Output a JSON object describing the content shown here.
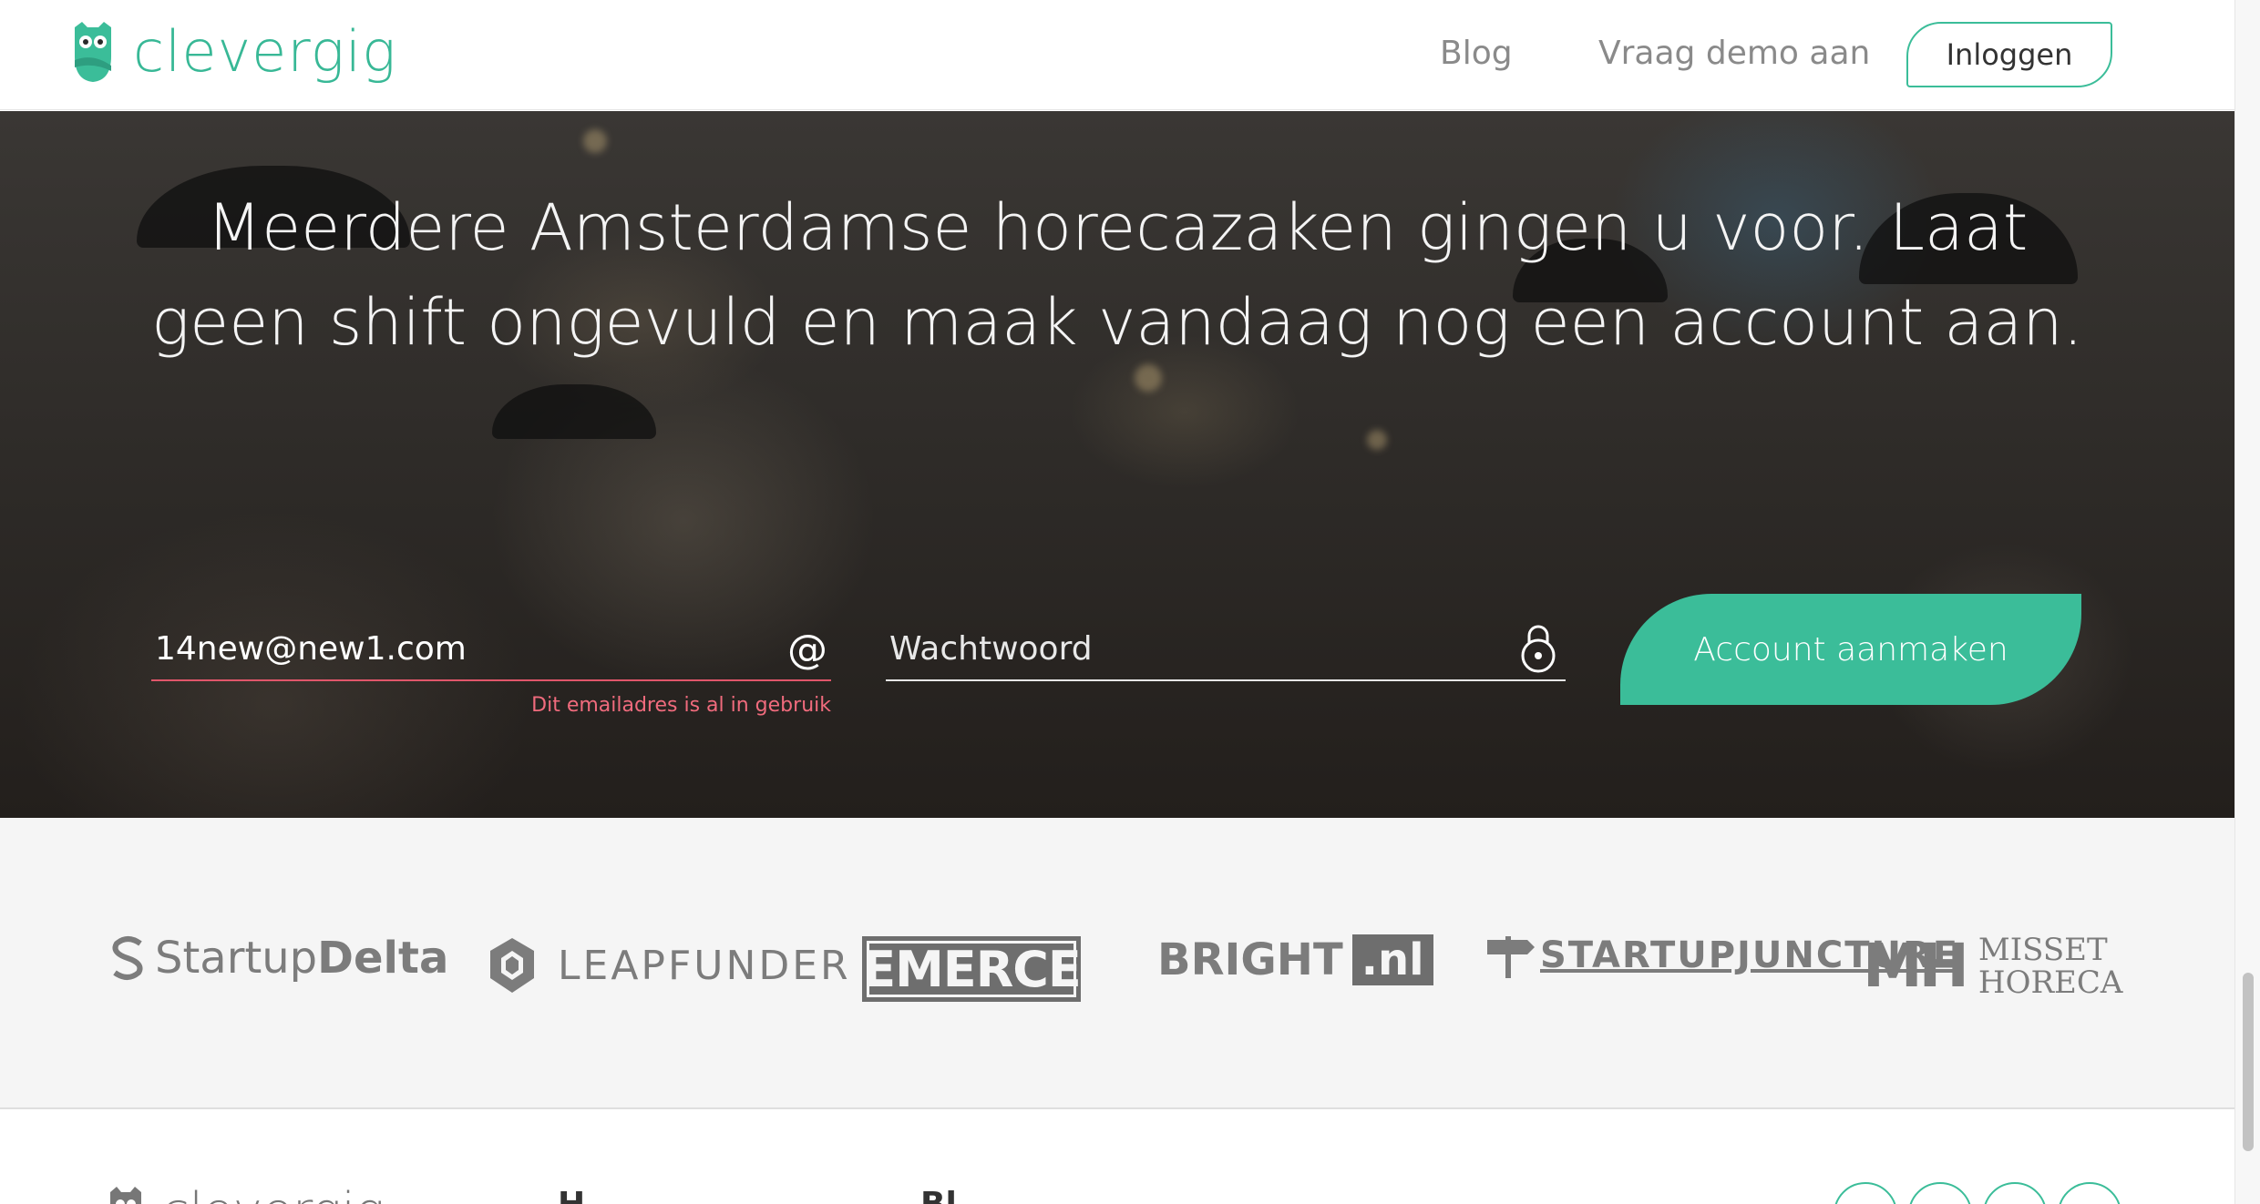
{
  "header": {
    "brand": "clevergig",
    "nav": {
      "blog": "Blog",
      "demo": "Vraag demo aan",
      "login": "Inloggen"
    }
  },
  "hero": {
    "title": "Meerdere Amsterdamse horecazaken gingen u voor. Laat geen shift ongevuld en maak vandaag nog een account aan.",
    "email": {
      "value": "14new@new1.com",
      "icon": "at-icon",
      "error": "Dit emailadres is al in gebruik"
    },
    "password": {
      "placeholder": "Wachtwoord",
      "icon": "lock-icon"
    },
    "submit_label": "Account aanmaken"
  },
  "partners": {
    "startupdelta": {
      "light": "Startup",
      "bold": "Delta"
    },
    "leapfunder": "LEAPFUNDER",
    "emerce": "EMERCE",
    "bright": {
      "name": "BRIGHT",
      "tld": ".nl"
    },
    "startupjuncture": "STARTUPJUNCTURE",
    "misset": {
      "mark": "MH",
      "line1": "MISSET",
      "line2": "HORECA"
    }
  },
  "footer": {
    "brand": "clevergig",
    "col1": "H",
    "col2": "Bl"
  },
  "colors": {
    "accent": "#3bbd99",
    "error": "#f06b7d",
    "partner_gray": "#7c7c7c"
  }
}
